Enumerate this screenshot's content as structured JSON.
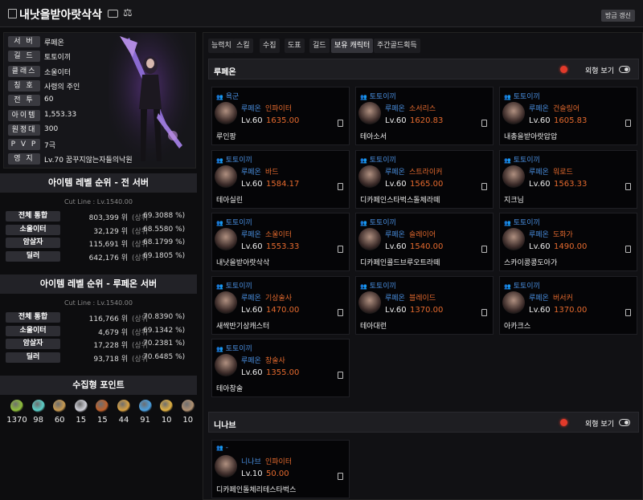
{
  "header": {
    "title": "내낫을받아랏삭삭",
    "update_label": "방금 갱신"
  },
  "profile": {
    "rows": [
      {
        "label": "서 버",
        "value": "루페온"
      },
      {
        "label": "길 드",
        "value": "토토이끼"
      },
      {
        "label": "클래스",
        "value": "소울이터"
      },
      {
        "label": "칭 호",
        "value": "사령의 주인"
      },
      {
        "label": "전 투",
        "value": "60"
      },
      {
        "label": "아이템",
        "value": "1,553.33"
      },
      {
        "label": "원정대",
        "value": "300"
      },
      {
        "label": "P V P",
        "value": "7극"
      },
      {
        "label": "영 지",
        "value": "Lv.70 꿈꾸지않는자들의낙원"
      }
    ]
  },
  "rank_all": {
    "title": "아이템 레벨 순위 - 전 서버",
    "cutline": "Cut Line : Lv.1540.00",
    "rows": [
      {
        "label": "전체 통합",
        "rank": "803,399 위",
        "sub": "(상위",
        "pct": "69.3088 %)"
      },
      {
        "label": "소울이터",
        "rank": "32,129 위",
        "sub": "(상위",
        "pct": "68.5580 %)"
      },
      {
        "label": "암살자",
        "rank": "115,691 위",
        "sub": "(상위",
        "pct": "68.1799 %)"
      },
      {
        "label": "딜러",
        "rank": "642,176 위",
        "sub": "(상위",
        "pct": "69.1805 %)"
      }
    ]
  },
  "rank_server": {
    "title": "아이템 레벨 순위 - 루페온 서버",
    "cutline": "Cut Line : Lv.1540.00",
    "rows": [
      {
        "label": "전체 통합",
        "rank": "116,766 위",
        "sub": "(상위",
        "pct": "70.8390 %)"
      },
      {
        "label": "소울이터",
        "rank": "4,679 위",
        "sub": "(상위",
        "pct": "69.1342 %)"
      },
      {
        "label": "암살자",
        "rank": "17,228 위",
        "sub": "(상위",
        "pct": "70.2381 %)"
      },
      {
        "label": "딜러",
        "rank": "93,718 위",
        "sub": "(상위",
        "pct": "70.6485 %)"
      }
    ]
  },
  "collect": {
    "title": "수집형 포인트",
    "items": [
      {
        "icon": "mokoko-seed-icon",
        "value": "1370",
        "color": "#8fbf3a"
      },
      {
        "icon": "island-heart-icon",
        "value": "98",
        "color": "#5ad0c8"
      },
      {
        "icon": "great-art-icon",
        "value": "60",
        "color": "#c89a50"
      },
      {
        "icon": "giant-heart-icon",
        "value": "15",
        "color": "#d0d0d8"
      },
      {
        "icon": "ignea-token-icon",
        "value": "15",
        "color": "#c0602a"
      },
      {
        "icon": "voyage-icon",
        "value": "44",
        "color": "#d8a040"
      },
      {
        "icon": "world-tree-leaf-icon",
        "value": "91",
        "color": "#4aa0e0"
      },
      {
        "icon": "orpheus-star-icon",
        "value": "10",
        "color": "#e0b040"
      },
      {
        "icon": "orgel-icon",
        "value": "10",
        "color": "#b09070"
      }
    ]
  },
  "tabs": [
    "능력치",
    "스킬",
    "수집",
    "도표",
    "길드",
    "보유 캐릭터",
    "주간골드획득"
  ],
  "tab_active": "보유 캐릭터",
  "servers": [
    {
      "name": "루페온",
      "view_label": "외형 보기",
      "cards": [
        {
          "guild": "욕군",
          "server": "루페온",
          "class": "인파이터",
          "level": "Lv.60",
          "item_level": "1635.00",
          "name": "루인팡"
        },
        {
          "guild": "토토이끼",
          "server": "루페온",
          "class": "소서리스",
          "level": "Lv.60",
          "item_level": "1620.83",
          "name": "테아소서"
        },
        {
          "guild": "토토이끼",
          "server": "루페온",
          "class": "건슬링어",
          "level": "Lv.60",
          "item_level": "1605.83",
          "name": "내총을받아랏압압"
        },
        {
          "guild": "토토이끼",
          "server": "루페온",
          "class": "바드",
          "level": "Lv.60",
          "item_level": "1584.17",
          "name": "테아실린"
        },
        {
          "guild": "토토이끼",
          "server": "루페온",
          "class": "스트라이커",
          "level": "Lv.60",
          "item_level": "1565.00",
          "name": "디카페인스타벅스돌체라떼"
        },
        {
          "guild": "토토이끼",
          "server": "루페온",
          "class": "워로드",
          "level": "Lv.60",
          "item_level": "1563.33",
          "name": "지크님"
        },
        {
          "guild": "토토이끼",
          "server": "루페온",
          "class": "소울이터",
          "level": "Lv.60",
          "item_level": "1553.33",
          "name": "내낫을받아랏삭삭"
        },
        {
          "guild": "토토이끼",
          "server": "루페온",
          "class": "슬레이어",
          "level": "Lv.60",
          "item_level": "1540.00",
          "name": "디카페인콜드브루오트라떼"
        },
        {
          "guild": "토토이끼",
          "server": "루페온",
          "class": "도화가",
          "level": "Lv.60",
          "item_level": "1490.00",
          "name": "스카이콩콩도아가"
        },
        {
          "guild": "토토이끼",
          "server": "루페온",
          "class": "기상술사",
          "level": "Lv.60",
          "item_level": "1470.00",
          "name": "새싹반기상캐스터"
        },
        {
          "guild": "토토이끼",
          "server": "루페온",
          "class": "블레이드",
          "level": "Lv.60",
          "item_level": "1370.00",
          "name": "테아대런"
        },
        {
          "guild": "토토이끼",
          "server": "루페온",
          "class": "버서커",
          "level": "Lv.60",
          "item_level": "1370.00",
          "name": "아카크스"
        },
        {
          "guild": "토토이끼",
          "server": "루페온",
          "class": "창술사",
          "level": "Lv.60",
          "item_level": "1355.00",
          "name": "테아창술"
        }
      ]
    },
    {
      "name": "니나브",
      "view_label": "외형 보기",
      "cards": [
        {
          "guild": "-",
          "server": "니나브",
          "class": "인파이터",
          "level": "Lv.10",
          "item_level": "50.00",
          "name": "디카페인돌체리테스타벅스"
        }
      ]
    }
  ]
}
